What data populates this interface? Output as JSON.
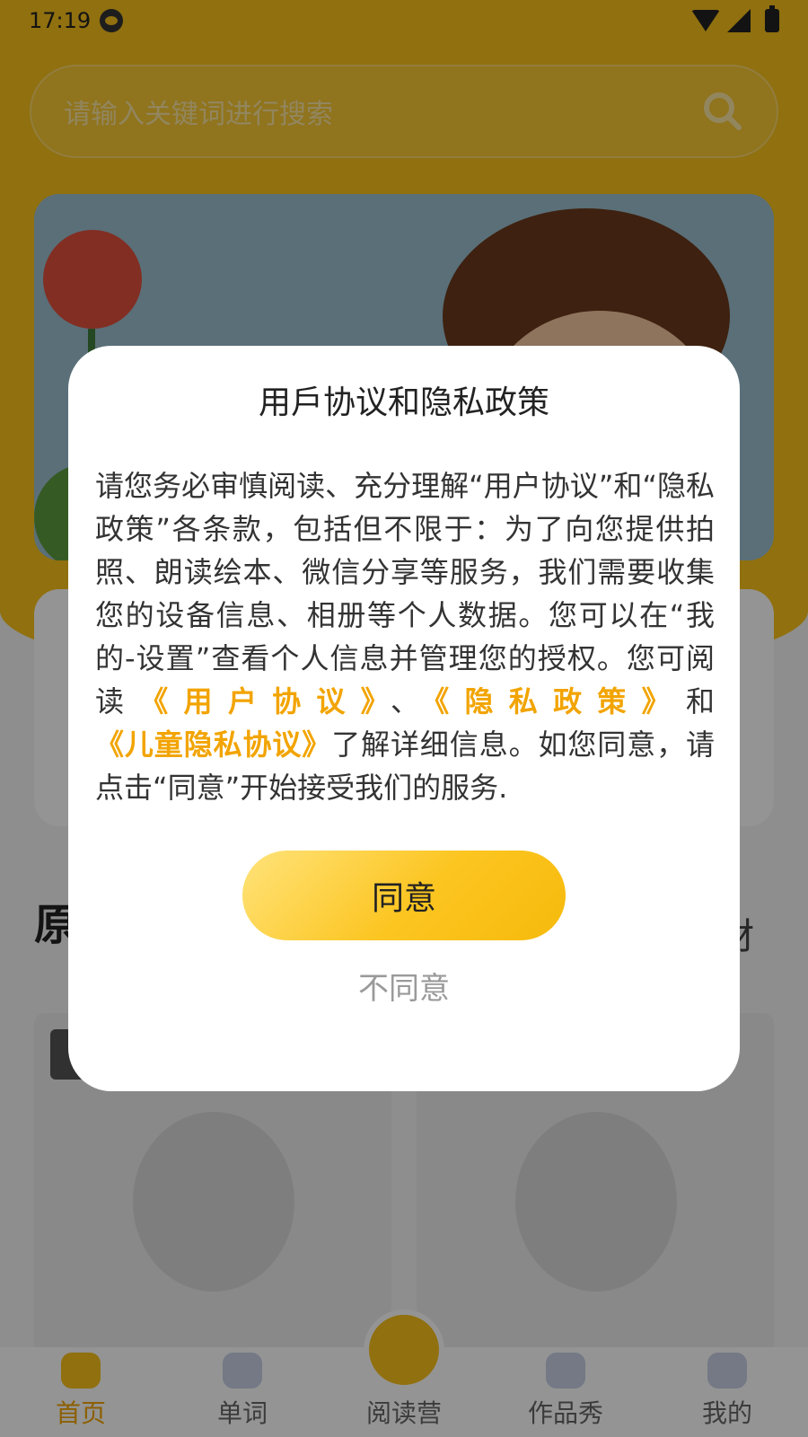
{
  "status_bar": {
    "time": "17:19"
  },
  "search": {
    "placeholder": "请输入关键词进行搜索"
  },
  "section": {
    "title": "原",
    "more": "材"
  },
  "tabs": [
    {
      "label": "首页",
      "icon": "home-icon",
      "active": true
    },
    {
      "label": "单词",
      "icon": "planet-icon",
      "active": false
    },
    {
      "label": "阅读营",
      "icon": "book-icon",
      "active": false
    },
    {
      "label": "作品秀",
      "icon": "star-icon",
      "active": false
    },
    {
      "label": "我的",
      "icon": "profile-icon",
      "active": false
    }
  ],
  "dialog": {
    "title": "用戶协议和隐私政策",
    "body_part1": "请您务必审慎阅读、充分理解“用户协议”和“隐私政策”各条款，包括但不限于：为了向您提供拍照、朗读绘本、微信分享等服务，我们需要收集您的设备信息、相册等个人数据。您可以在“我的-设置”查看个人信息并管理您的授权。您可阅读",
    "link_user_agreement": "《用户协议》",
    "sep1": "、",
    "link_privacy_policy": "《隐私政策》",
    "sep2": "和",
    "link_child_privacy": "《儿童隐私协议》",
    "body_part2": "了解详细信息。如您同意，请点击“同意”开始接受我们的服务.",
    "agree_label": "同意",
    "disagree_label": "不同意"
  },
  "colors": {
    "accent": "#f8c21a",
    "link": "#f2a400"
  }
}
